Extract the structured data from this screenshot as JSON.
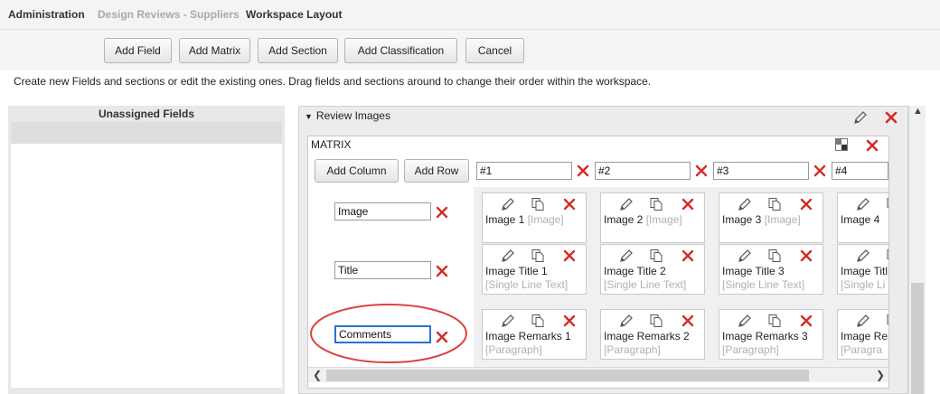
{
  "breadcrumb": {
    "items": [
      "Administration",
      "Design Reviews - Suppliers",
      "Workspace Layout"
    ]
  },
  "toolbar": {
    "add_field": "Add Field",
    "add_matrix": "Add Matrix",
    "add_section": "Add Section",
    "add_classification": "Add Classification",
    "cancel": "Cancel"
  },
  "instructions": "Create new Fields and sections or edit the existing ones. Drag fields and sections around to change their order within the workspace.",
  "unassigned": {
    "title": "Unassigned Fields"
  },
  "section": {
    "title": "Review Images",
    "collapse_glyph": "▼"
  },
  "matrix": {
    "label": "MATRIX",
    "add_column": "Add Column",
    "add_row": "Add Row",
    "columns": [
      "#1",
      "#2",
      "#3",
      "#4"
    ],
    "rows": [
      "Image",
      "Title",
      "Comments"
    ],
    "cells": [
      [
        {
          "name": "Image 1",
          "type": "[Image]",
          "sub": ""
        },
        {
          "name": "Image 2",
          "type": "[Image]",
          "sub": ""
        },
        {
          "name": "Image 3",
          "type": "[Image]",
          "sub": ""
        },
        {
          "name": "Image 4",
          "type": "",
          "sub": ""
        }
      ],
      [
        {
          "name": "Image Title 1",
          "type": "",
          "sub": "[Single Line Text]"
        },
        {
          "name": "Image Title 2",
          "type": "",
          "sub": "[Single Line Text]"
        },
        {
          "name": "Image Title 3",
          "type": "",
          "sub": "[Single Line Text]"
        },
        {
          "name": "Image Titl",
          "type": "",
          "sub": "[Single Li"
        }
      ],
      [
        {
          "name": "Image Remarks 1",
          "type": "",
          "sub": "[Paragraph]"
        },
        {
          "name": "Image Remarks 2",
          "type": "",
          "sub": "[Paragraph]"
        },
        {
          "name": "Image Remarks 3",
          "type": "",
          "sub": "[Paragraph]"
        },
        {
          "name": "Image Re",
          "type": "",
          "sub": "[Paragra"
        }
      ]
    ]
  },
  "colors": {
    "delete_red": "#d42b2b",
    "highlight_circle": "#e04040",
    "focus_blue": "#2b6fd6"
  },
  "icons": [
    "pencil-icon",
    "copy-icon",
    "delete-icon",
    "matrix-settings-icon",
    "collapse-triangle-icon"
  ]
}
